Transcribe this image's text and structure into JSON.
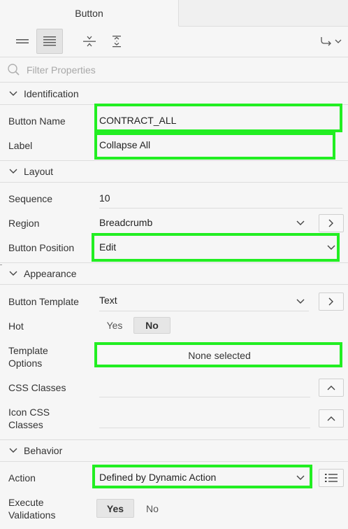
{
  "tab": {
    "label": "Button"
  },
  "filter": {
    "placeholder": "Filter Properties"
  },
  "groups": {
    "identification": "Identification",
    "layout": "Layout",
    "appearance": "Appearance",
    "behavior": "Behavior"
  },
  "fields": {
    "button_name": {
      "label": "Button Name",
      "value": "CONTRACT_ALL"
    },
    "label": {
      "label": "Label",
      "value": "Collapse All"
    },
    "sequence": {
      "label": "Sequence",
      "value": "10"
    },
    "region": {
      "label": "Region",
      "value": "Breadcrumb"
    },
    "button_position": {
      "label": "Button Position",
      "value": "Edit"
    },
    "button_template": {
      "label": "Button Template",
      "value": "Text"
    },
    "hot": {
      "label": "Hot",
      "yes": "Yes",
      "no": "No",
      "selected": "No"
    },
    "template_options": {
      "label_line1": "Template",
      "label_line2": "Options",
      "value": "None selected"
    },
    "css_classes": {
      "label": "CSS Classes",
      "value": ""
    },
    "icon_css_classes": {
      "label_line1": "Icon CSS",
      "label_line2": "Classes",
      "value": ""
    },
    "action": {
      "label": "Action",
      "value": "Defined by Dynamic Action"
    },
    "execute_validations": {
      "label_line1": "Execute",
      "label_line2": "Validations",
      "yes": "Yes",
      "no": "No",
      "selected": "Yes"
    }
  },
  "colors": {
    "highlight": "#22ee22",
    "background": "#f6f6f6",
    "border": "#dddddd"
  }
}
